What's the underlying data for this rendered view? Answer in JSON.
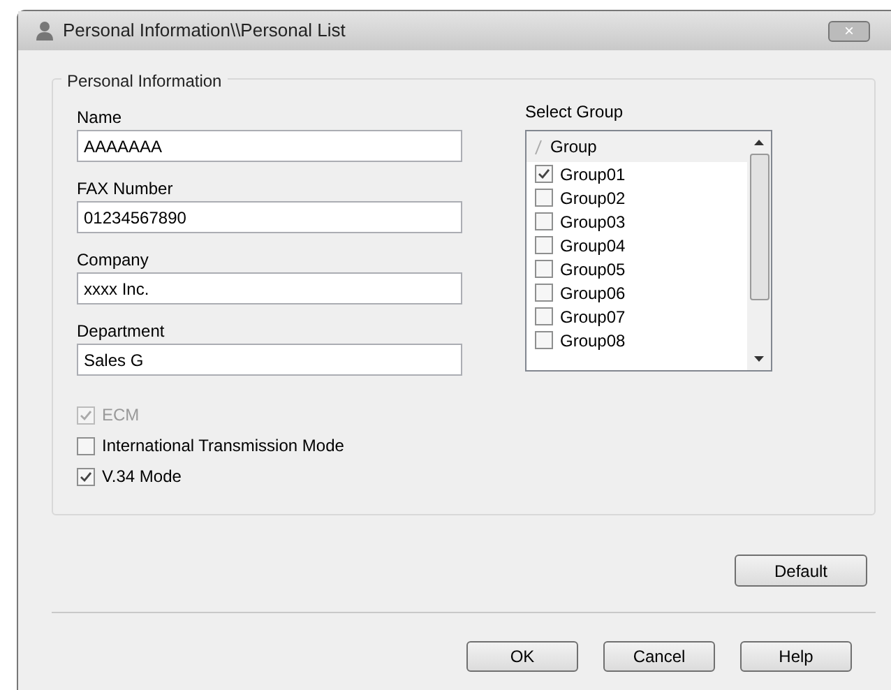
{
  "window": {
    "title": "Personal Information\\\\Personal List",
    "close": "×"
  },
  "group_box": {
    "title": "Personal Information"
  },
  "fields": [
    {
      "label": "Name",
      "value": "AAAAAAA"
    },
    {
      "label": "FAX Number",
      "value": "01234567890"
    },
    {
      "label": "Company",
      "value": "xxxx Inc."
    },
    {
      "label": "Department",
      "value": "Sales G"
    }
  ],
  "options": [
    {
      "label": "ECM",
      "checked": true,
      "disabled": true
    },
    {
      "label": "International Transmission Mode",
      "checked": false,
      "disabled": false
    },
    {
      "label": "V.34 Mode",
      "checked": true,
      "disabled": false
    }
  ],
  "select_group": {
    "title": "Select Group",
    "column": "Group",
    "items": [
      {
        "label": "Group01",
        "checked": true
      },
      {
        "label": "Group02",
        "checked": false
      },
      {
        "label": "Group03",
        "checked": false
      },
      {
        "label": "Group04",
        "checked": false
      },
      {
        "label": "Group05",
        "checked": false
      },
      {
        "label": "Group06",
        "checked": false
      },
      {
        "label": "Group07",
        "checked": false
      },
      {
        "label": "Group08",
        "checked": false
      }
    ]
  },
  "default_button": "Default",
  "buttons": [
    "OK",
    "Cancel",
    "Help"
  ]
}
